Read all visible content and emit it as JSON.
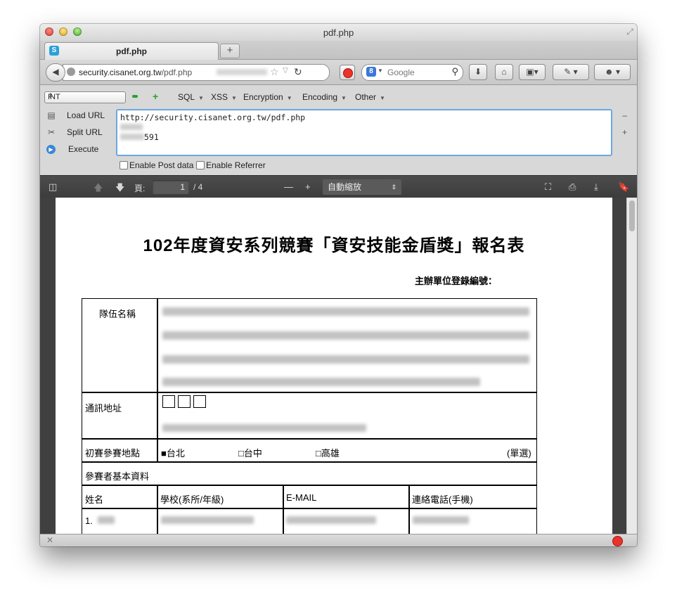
{
  "window": {
    "title": "pdf.php"
  },
  "tab": {
    "label": "pdf.php",
    "favicon": "S",
    "new_tab": "+"
  },
  "navbar": {
    "url_host": "security.cisanet.org.tw",
    "url_path": "/pdf.php",
    "search_placeholder": "Google",
    "search_engine_icon": "8"
  },
  "hackbar": {
    "select_value": "INT",
    "menus": [
      "SQL",
      "XSS",
      "Encryption",
      "Encoding",
      "Other"
    ],
    "actions": {
      "load": "Load URL",
      "split": "Split URL",
      "execute": "Execute"
    },
    "textarea_line1": "http://security.cisanet.org.tw/pdf.php",
    "textarea_line3": "591",
    "enable_post": "Enable Post data",
    "enable_referrer": "Enable Referrer",
    "side_minus": "–",
    "side_plus": "+"
  },
  "pdf_toolbar": {
    "page_label": "頁:",
    "page_current": "1",
    "page_total": "/ 4",
    "zoom_minus": "—",
    "zoom_plus": "+",
    "zoom_value": "自動縮放"
  },
  "document": {
    "title": "102年度資安系列競賽「資安技能金盾獎」報名表",
    "registration_label": "主辦單位登錄編號：",
    "team_name_label": "隊伍名稱",
    "address_label": "通訊地址",
    "venue_label": "初賽參賽地點",
    "venue_options": [
      "■台北",
      "□台中",
      "□高雄"
    ],
    "venue_note": "(單選)",
    "participants_label": "參賽者基本資料",
    "columns": [
      "姓名",
      "學校(系所/年級)",
      "E-MAIL",
      "連絡電話(手機)"
    ],
    "row1_index": "1."
  }
}
